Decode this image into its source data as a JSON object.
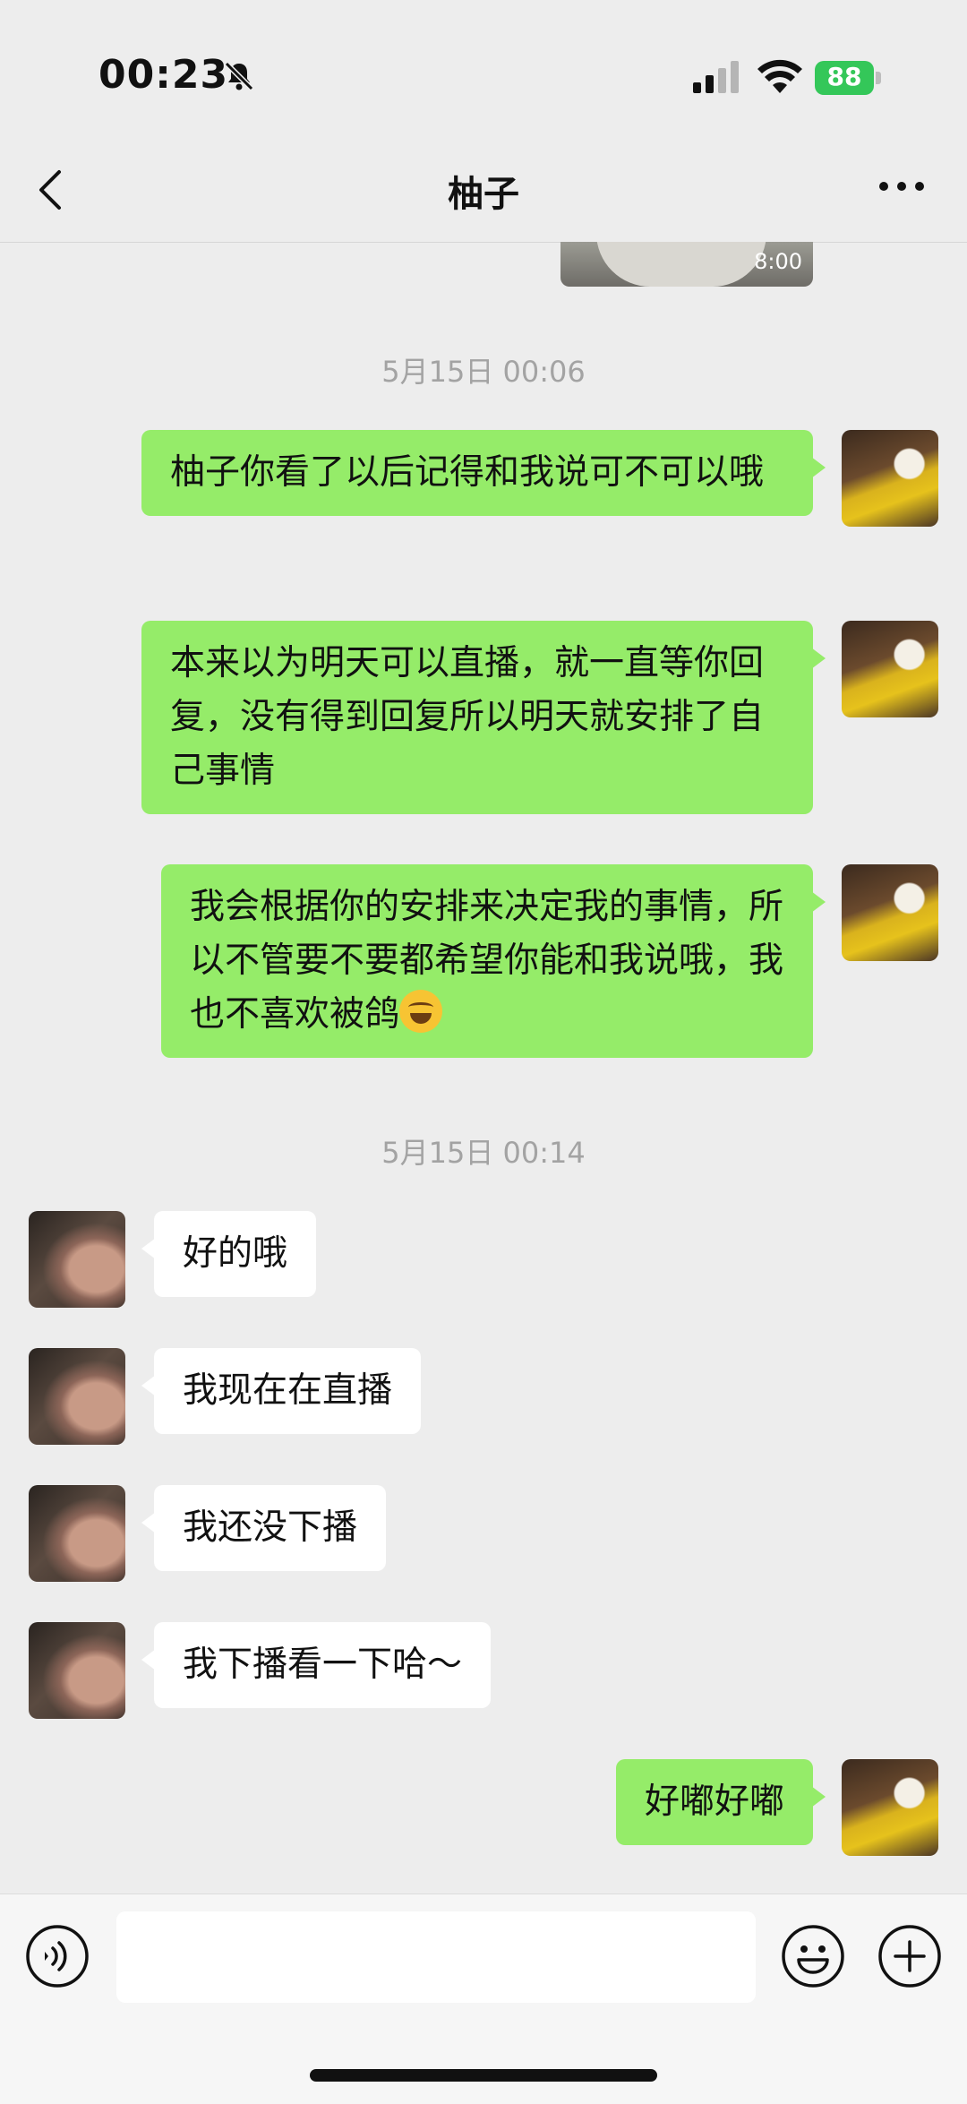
{
  "status_bar": {
    "time": "00:23",
    "battery": "88"
  },
  "nav": {
    "title": "柚子"
  },
  "media": {
    "duration": "8:00"
  },
  "timestamps": [
    "5月15日 00:06",
    "5月15日 00:14"
  ],
  "messages": [
    {
      "side": "out",
      "text": "柚子你看了以后记得和我说可不可以哦"
    },
    {
      "side": "out",
      "text": "本来以为明天可以直播，就一直等你回复，没有得到回复所以明天就安排了自己事情"
    },
    {
      "side": "out",
      "text": "我会根据你的安排来决定我的事情，所以不管要不要都希望你能和我说哦，我也不喜欢被鸽"
    },
    {
      "side": "in",
      "text": "好的哦"
    },
    {
      "side": "in",
      "text": "我现在在直播"
    },
    {
      "side": "in",
      "text": "我还没下播"
    },
    {
      "side": "in",
      "text": "我下播看一下哈～"
    },
    {
      "side": "out",
      "text": "好嘟好嘟"
    }
  ],
  "input": {
    "value": ""
  },
  "colors": {
    "outgoing_bubble": "#95ec69",
    "incoming_bubble": "#ffffff",
    "background": "#ededed"
  }
}
